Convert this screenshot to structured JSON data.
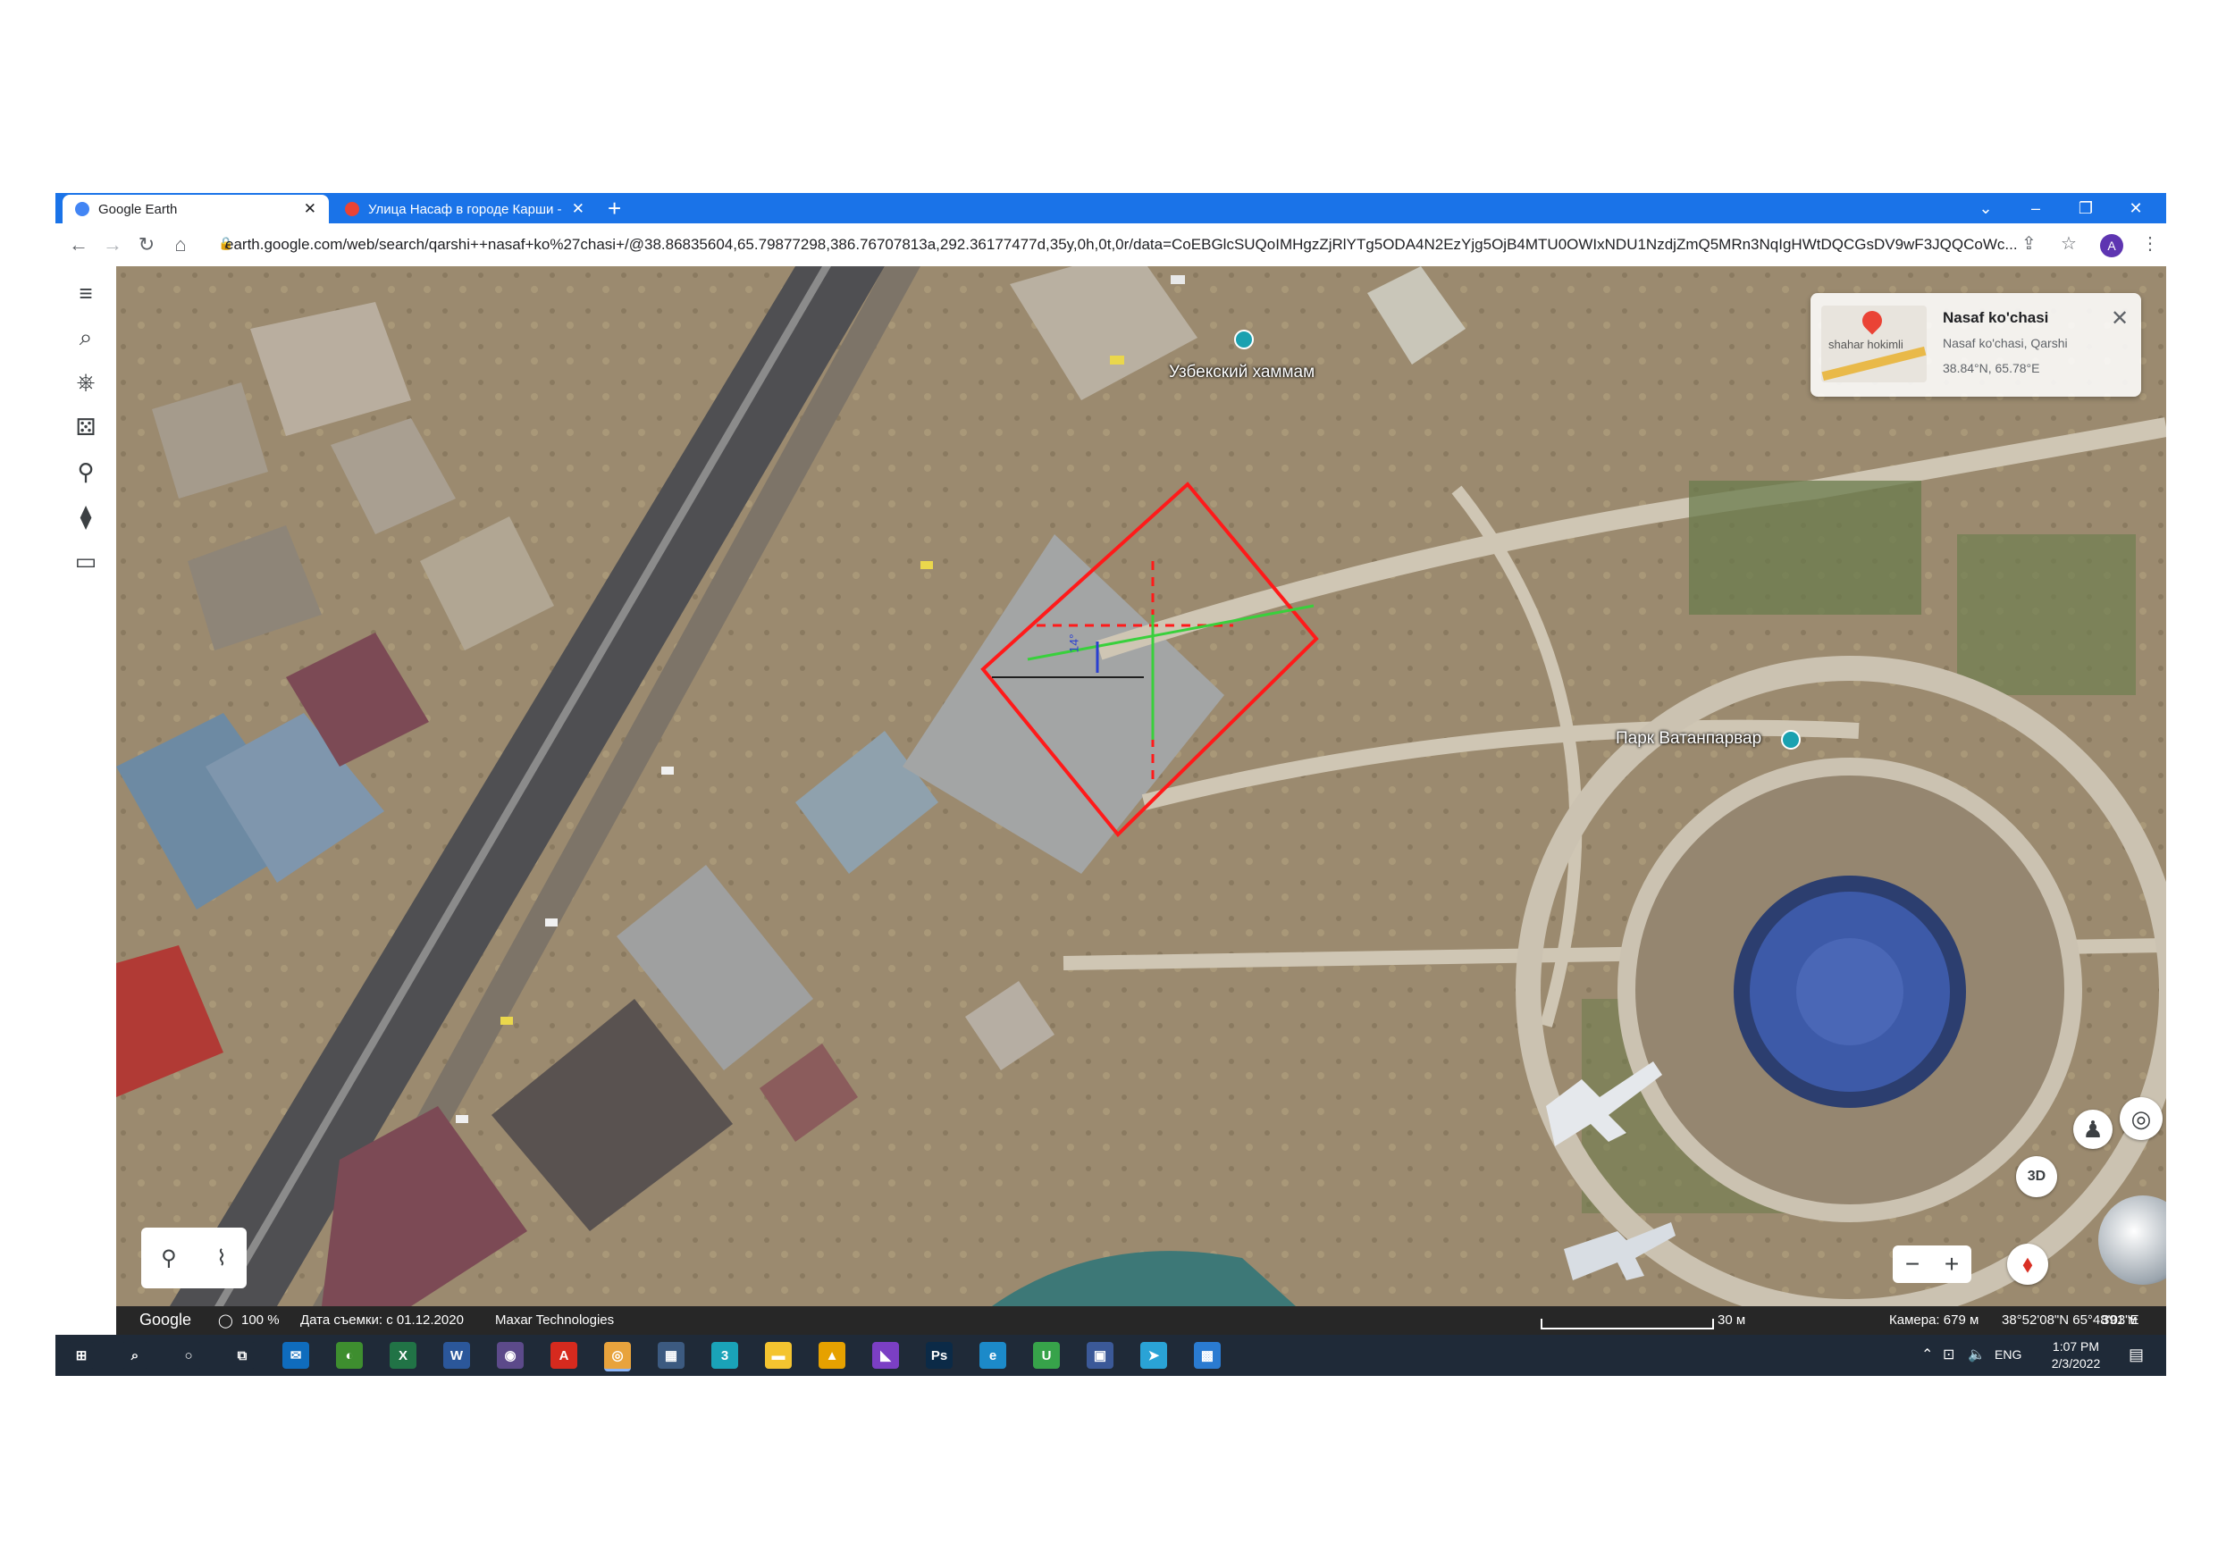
{
  "browser": {
    "tabs": [
      {
        "title": "Google Earth",
        "active": true,
        "favicon_color": "#4285f4"
      },
      {
        "title": "Улица Насаф в городе Карши -",
        "active": false,
        "favicon_color": "#ea4335"
      }
    ],
    "url": "earth.google.com/web/search/qarshi++nasaf+ko%27chasi+/@38.86835604,65.79877298,386.76707813a,292.36177477d,35y,0h,0t,0r/data=CoEBGlcSUQoIMHgzZjRlYTg5ODA4N2EzYjg5OjB4MTU0OWIxNDU1NzdjZmQ5MRn3NqIgHWtDQCGsDV9wF3JQQCoWc...",
    "avatar_letter": "A",
    "window_controls": [
      "⌄",
      "–",
      "❐",
      "✕"
    ]
  },
  "sidebar": {
    "items": [
      {
        "name": "menu-icon",
        "glyph": "≡"
      },
      {
        "name": "search-icon",
        "glyph": "⌕"
      },
      {
        "name": "voyager-icon",
        "glyph": "⎈"
      },
      {
        "name": "feeling-lucky-icon",
        "glyph": "⚄"
      },
      {
        "name": "projects-icon",
        "glyph": "⚲"
      },
      {
        "name": "map-style-icon",
        "glyph": "⧫"
      },
      {
        "name": "measure-icon",
        "glyph": "▭"
      }
    ]
  },
  "map": {
    "labels": {
      "hammam": "Узбекский хаммам",
      "park": "Парк Ватанпарвар"
    },
    "measurement": {
      "angle_label": "14°",
      "outline_color": "#ff1a1a",
      "axis_color": "#39d03c"
    },
    "info_card": {
      "name": "Nasaf ko'chasi",
      "address": "Nasaf ko'chasi, Qarshi",
      "coords": "38.84°N, 65.78°E",
      "thumb_text": "shahar hokimli",
      "close_glyph": "✕"
    },
    "controls": {
      "pegman_glyph": "♟",
      "locate_glyph": "◎",
      "mode_label": "3D",
      "zoom_out": "−",
      "zoom_in": "+",
      "compass_glyph": "⬧"
    },
    "place_tools": {
      "pin_glyph": "⚲",
      "path_glyph": "⌇"
    }
  },
  "status": {
    "brand": "Google",
    "loading_percent": "100 %",
    "capture_date": "Дата съемки: с 01.12.2020",
    "provider": "Maxar Technologies",
    "scale_label": "30 м",
    "camera": "Камера: 679 м",
    "position": "38°52'08\"N 65°48'03\"E",
    "elevation": "391 м"
  },
  "taskbar": {
    "apps": [
      {
        "name": "windows-start-icon",
        "glyph": "⊞",
        "color": "#1f2a38"
      },
      {
        "name": "taskbar-search-icon",
        "glyph": "⌕",
        "color": "#1f2a38"
      },
      {
        "name": "cortana-icon",
        "glyph": "○",
        "color": "#1f2a38"
      },
      {
        "name": "task-view-icon",
        "glyph": "⧉",
        "color": "#1f2a38"
      },
      {
        "name": "mail-icon",
        "glyph": "✉",
        "color": "#0f6cbd"
      },
      {
        "name": "app-green-icon",
        "glyph": "◐",
        "color": "#3e8e2f"
      },
      {
        "name": "excel-icon",
        "glyph": "X",
        "color": "#217346"
      },
      {
        "name": "word-icon",
        "glyph": "W",
        "color": "#2b579a"
      },
      {
        "name": "app-orb-icon",
        "glyph": "◉",
        "color": "#5c4a8a"
      },
      {
        "name": "acrobat-icon",
        "glyph": "A",
        "color": "#d62a1e"
      },
      {
        "name": "chrome-icon",
        "glyph": "◎",
        "color": "#e8a33d"
      },
      {
        "name": "calculator-icon",
        "glyph": "▦",
        "color": "#3c5a80"
      },
      {
        "name": "app-3-icon",
        "glyph": "3",
        "color": "#1aa3b8"
      },
      {
        "name": "file-explorer-icon",
        "glyph": "▬",
        "color": "#f4c430"
      },
      {
        "name": "autocad-icon",
        "glyph": "▲",
        "color": "#e6a100"
      },
      {
        "name": "visual-studio-icon",
        "glyph": "◣",
        "color": "#7b3fc4"
      },
      {
        "name": "photoshop-icon",
        "glyph": "Ps",
        "color": "#0b2a47"
      },
      {
        "name": "edge-icon",
        "glyph": "e",
        "color": "#1c8ac9"
      },
      {
        "name": "app-u-icon",
        "glyph": "U",
        "color": "#37a34a"
      },
      {
        "name": "save-icon",
        "glyph": "▣",
        "color": "#3b5998"
      },
      {
        "name": "telegram-icon",
        "glyph": "➤",
        "color": "#2aa3d6"
      },
      {
        "name": "photos-icon",
        "glyph": "▩",
        "color": "#2a7bd1"
      }
    ],
    "language": "ENG",
    "time": "1:07 PM",
    "date": "2/3/2022"
  }
}
